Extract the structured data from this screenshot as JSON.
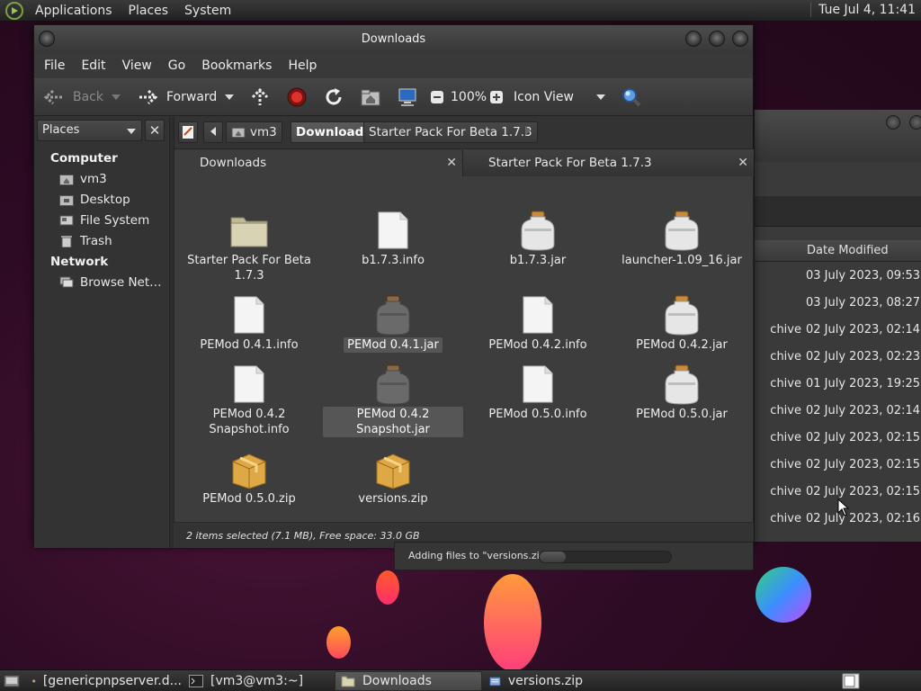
{
  "top_panel": {
    "menus": [
      "Applications",
      "Places",
      "System"
    ],
    "clock": "Tue Jul  4, 11:41"
  },
  "window": {
    "title": "Downloads",
    "menubar": [
      "File",
      "Edit",
      "View",
      "Go",
      "Bookmarks",
      "Help"
    ],
    "toolbar": {
      "back_label": "Back",
      "forward_label": "Forward",
      "zoom_label": "100%",
      "view_mode": "Icon View"
    },
    "sidebar": {
      "header": "Places",
      "close": "✕",
      "groups": [
        {
          "title": "Computer",
          "items": [
            {
              "label": "vm3",
              "icon": "home-folder-icon"
            },
            {
              "label": "Desktop",
              "icon": "desktop-folder-icon"
            },
            {
              "label": "File System",
              "icon": "drive-icon"
            },
            {
              "label": "Trash",
              "icon": "trash-icon"
            }
          ]
        },
        {
          "title": "Network",
          "items": [
            {
              "label": "Browse Net…",
              "icon": "network-icon"
            }
          ]
        }
      ]
    },
    "pathbar": [
      "vm3",
      "Downloads",
      "Starter Pack For Beta 1.7.3"
    ],
    "tabs": [
      {
        "label": "Downloads",
        "close": "✕"
      },
      {
        "label": "Starter Pack For Beta 1.7.3",
        "close": "✕"
      }
    ],
    "files": [
      {
        "name": "Starter Pack For Beta 1.7.3",
        "type": "folder",
        "selected": false
      },
      {
        "name": "b1.7.3.info",
        "type": "document",
        "selected": false
      },
      {
        "name": "b1.7.3.jar",
        "type": "jar",
        "selected": false
      },
      {
        "name": "launcher-1.09_16.jar",
        "type": "jar",
        "selected": false
      },
      {
        "name": "PEMod 0.4.1.info",
        "type": "document",
        "selected": false
      },
      {
        "name": "PEMod 0.4.1.jar",
        "type": "jar",
        "selected": true
      },
      {
        "name": "PEMod 0.4.2.info",
        "type": "document",
        "selected": false
      },
      {
        "name": "PEMod 0.4.2.jar",
        "type": "jar",
        "selected": false
      },
      {
        "name": "PEMod 0.4.2 Snapshot.info",
        "type": "document",
        "selected": false
      },
      {
        "name": "PEMod 0.4.2 Snapshot.jar",
        "type": "jar",
        "selected": true
      },
      {
        "name": "PEMod 0.5.0.info",
        "type": "document",
        "selected": false
      },
      {
        "name": "PEMod 0.5.0.jar",
        "type": "jar",
        "selected": false
      },
      {
        "name": "PEMod 0.5.0.zip",
        "type": "archive",
        "selected": false
      },
      {
        "name": "versions.zip",
        "type": "archive",
        "selected": false
      }
    ],
    "status": "2 items selected (7.1 MB), Free space: 33.0 GB"
  },
  "background_window": {
    "column_header": "Date Modified",
    "rows": [
      {
        "kind": "",
        "date": "03 July 2023, 09:53"
      },
      {
        "kind": "",
        "date": "03 July 2023, 08:27"
      },
      {
        "kind": "chive",
        "date": "02 July 2023, 02:14"
      },
      {
        "kind": "chive",
        "date": "02 July 2023, 02:23"
      },
      {
        "kind": "chive",
        "date": "01 July 2023, 19:25"
      },
      {
        "kind": "chive",
        "date": "02 July 2023, 02:14"
      },
      {
        "kind": "chive",
        "date": "02 July 2023, 02:15"
      },
      {
        "kind": "chive",
        "date": "02 July 2023, 02:15"
      },
      {
        "kind": "chive",
        "date": "02 July 2023, 02:15"
      },
      {
        "kind": "chive",
        "date": "02 July 2023, 02:16"
      }
    ]
  },
  "progress": {
    "text": "Adding files to \"versions.zip\"",
    "fraction": 0.2
  },
  "taskbar": {
    "tasks": [
      {
        "label": "[genericpnpserver.d...",
        "icon": "chrome-icon",
        "active": false
      },
      {
        "label": "[vm3@vm3:~]",
        "icon": "terminal-icon",
        "active": false
      },
      {
        "label": "Downloads",
        "icon": "folder-icon",
        "active": true
      },
      {
        "label": "versions.zip",
        "icon": "archive-manager-icon",
        "active": false
      }
    ]
  },
  "colors": {
    "accent_orange": "#ff6f3c",
    "folder": "#cfc9a8",
    "archive": "#e8b44c"
  }
}
